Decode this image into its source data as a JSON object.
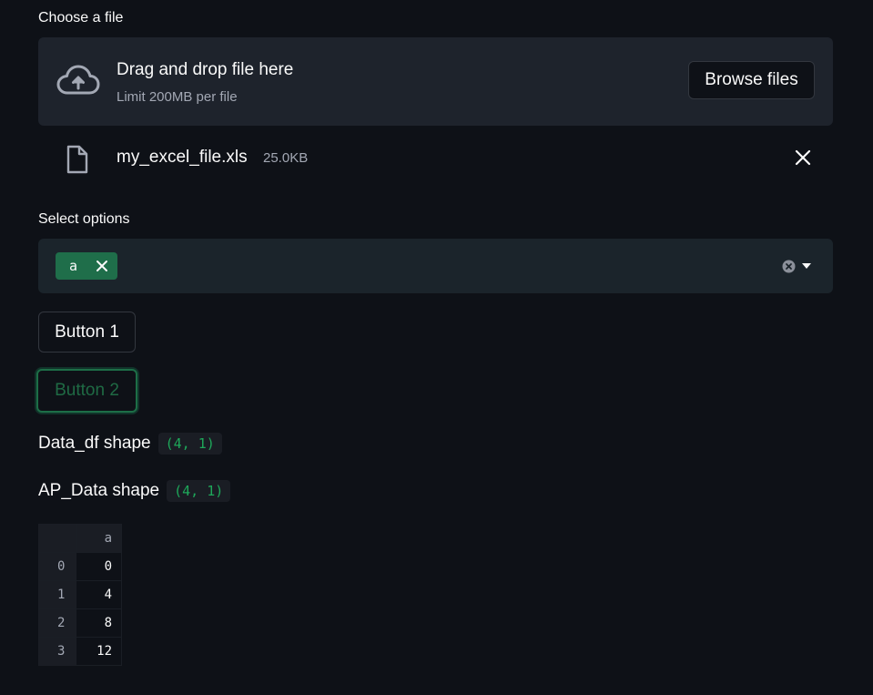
{
  "uploader": {
    "label": "Choose a file",
    "dropzone_title": "Drag and drop file here",
    "dropzone_subtitle": "Limit 200MB per file",
    "browse_label": "Browse files",
    "file": {
      "name": "my_excel_file.xls",
      "size": "25.0KB"
    }
  },
  "multiselect": {
    "label": "Select options",
    "selected_tag": "a",
    "tag_color": "#1f6e4a"
  },
  "buttons": {
    "button1_label": "Button 1",
    "button2_label": "Button 2"
  },
  "shapes": {
    "data_df_label": "Data_df shape",
    "data_df_value": "(4, 1)",
    "ap_data_label": "AP_Data shape",
    "ap_data_value": "(4, 1)"
  },
  "dataframe": {
    "columns": [
      "a"
    ],
    "rows": [
      {
        "index": "0",
        "a": "0"
      },
      {
        "index": "1",
        "a": "4"
      },
      {
        "index": "2",
        "a": "8"
      },
      {
        "index": "3",
        "a": "12"
      }
    ]
  },
  "colors": {
    "background": "#0e1117",
    "accent_green": "#1ea85a",
    "panel": "#1e232c"
  }
}
